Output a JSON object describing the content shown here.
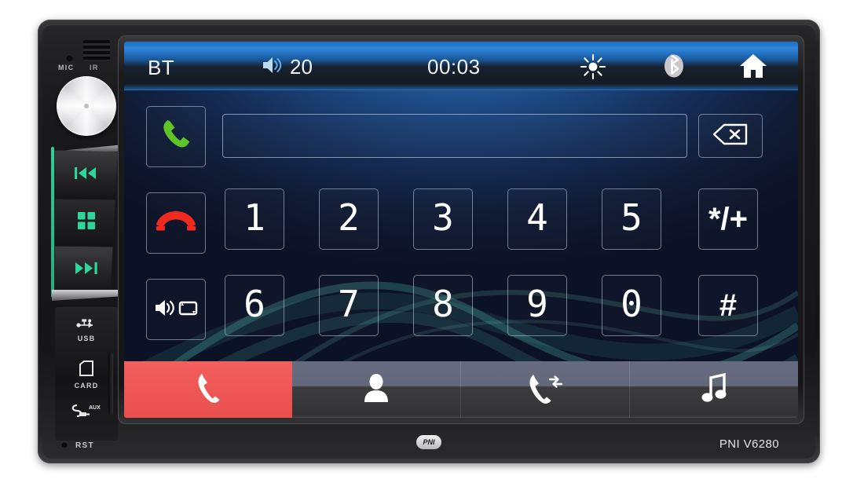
{
  "device": {
    "brand_badge": "PNI",
    "model_label": "PNI V6280",
    "reset_label": "RST",
    "mic_label": "MIC",
    "ir_label": "IR",
    "io_ports": [
      {
        "name": "usb",
        "label": "USB",
        "icon": "usb-icon"
      },
      {
        "name": "card",
        "label": "CARD",
        "icon": "sd-card-icon"
      },
      {
        "name": "aux",
        "label": "AUX",
        "icon": "aux-jack-icon"
      }
    ],
    "side_keys": [
      {
        "name": "previous-track",
        "icon": "previous-track-icon"
      },
      {
        "name": "menu",
        "icon": "grid-menu-icon"
      },
      {
        "name": "next-track",
        "icon": "next-track-icon"
      }
    ],
    "knob": {
      "name": "volume-power-knob"
    },
    "accent_green": "#2fd69c",
    "accent_red": "#ee5655"
  },
  "status_bar": {
    "source_label": "BT",
    "volume_icon": "speaker-volume-icon",
    "volume_value": "20",
    "clock": "00:03",
    "brightness_icon": "brightness-sun-icon",
    "bluetooth_icon": "bluetooth-icon",
    "home_icon": "home-icon"
  },
  "dialer": {
    "number_value": "",
    "number_placeholder": "",
    "backspace_icon": "backspace-icon",
    "actions": [
      {
        "name": "call-button",
        "icon": "phone-call-icon",
        "color": "#5ec427"
      },
      {
        "name": "hangup-button",
        "icon": "phone-hangup-icon",
        "color": "#ef2b1f"
      },
      {
        "name": "audio-transfer-button",
        "icon": "speaker-swap-icon",
        "color": "#ffffff"
      }
    ],
    "keys_row1": [
      "1",
      "2",
      "3",
      "4",
      "5"
    ],
    "key_star": "*/+",
    "keys_row2": [
      "6",
      "7",
      "8",
      "9",
      "0"
    ],
    "key_hash": "#"
  },
  "tabs": [
    {
      "name": "tab-dialer",
      "icon": "phone-handset-icon",
      "active": true
    },
    {
      "name": "tab-contacts",
      "icon": "person-icon",
      "active": false
    },
    {
      "name": "tab-call-history",
      "icon": "phone-transfer-icon",
      "active": false
    },
    {
      "name": "tab-music",
      "icon": "music-note-icon",
      "active": false
    }
  ]
}
